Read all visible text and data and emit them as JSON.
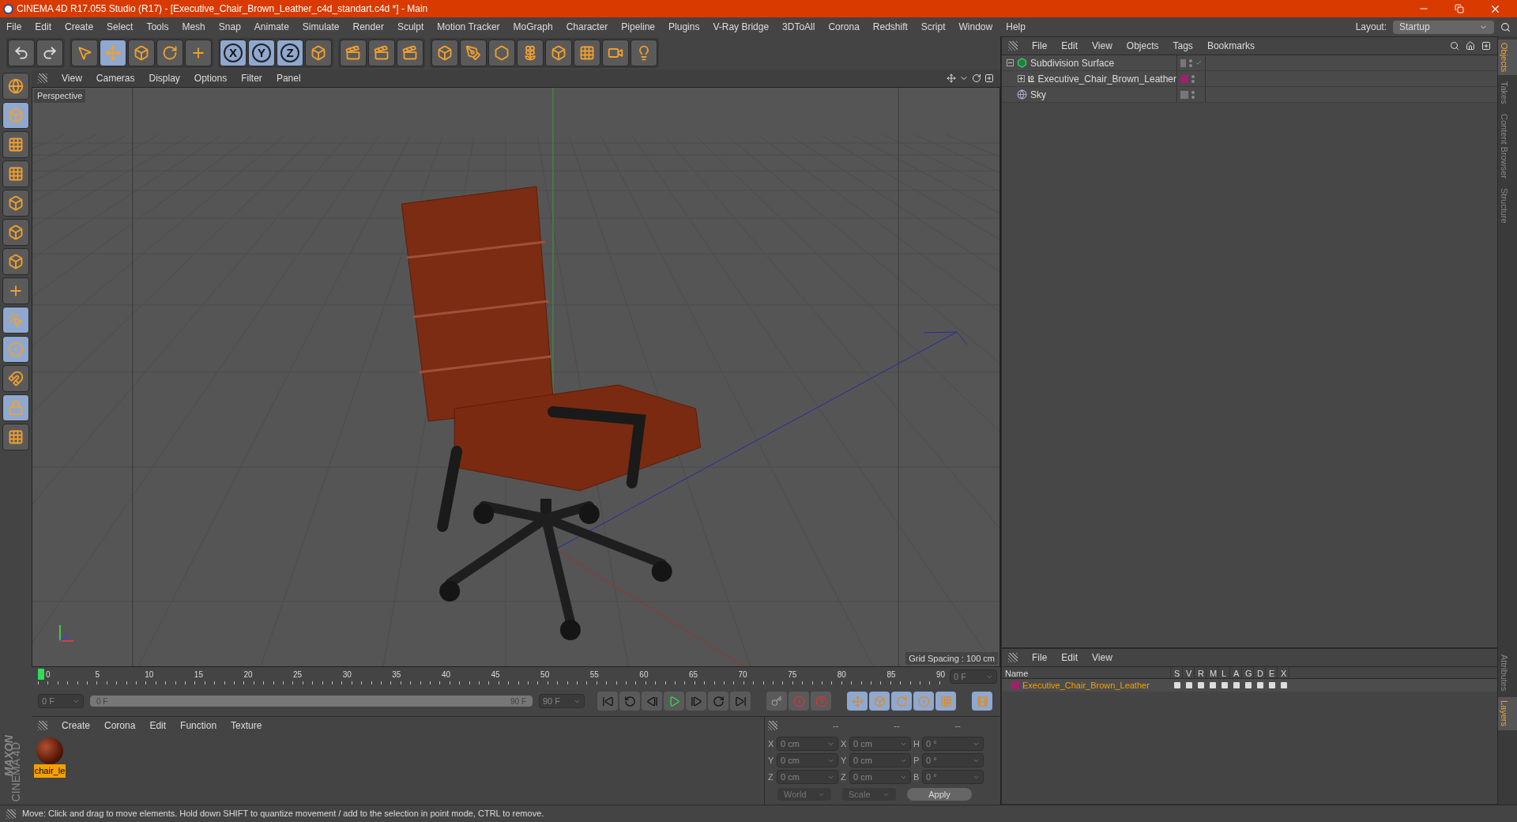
{
  "window": {
    "title": "CINEMA 4D R17.055 Studio (R17) - [Executive_Chair_Brown_Leather_c4d_standart.c4d *] - Main"
  },
  "menu_bar": [
    "File",
    "Edit",
    "Create",
    "Select",
    "Tools",
    "Mesh",
    "Snap",
    "Animate",
    "Simulate",
    "Render",
    "Sculpt",
    "Motion Tracker",
    "MoGraph",
    "Character",
    "Pipeline",
    "Plugins",
    "V-Ray Bridge",
    "3DToAll",
    "Corona",
    "Redshift",
    "Script",
    "Window",
    "Help"
  ],
  "layout": {
    "label": "Layout:",
    "value": "Startup"
  },
  "toolbar": {
    "groups": [
      [
        {
          "kind": "undo",
          "selected": false
        },
        {
          "kind": "redo",
          "selected": false
        }
      ],
      [
        {
          "kind": "cursor",
          "selected": false
        },
        {
          "kind": "move",
          "selected": true
        },
        {
          "kind": "scale",
          "selected": false
        },
        {
          "kind": "rotate",
          "selected": false
        },
        {
          "kind": "cross",
          "selected": false
        }
      ],
      [
        {
          "kind": "axis",
          "label": "X",
          "selected": true
        },
        {
          "kind": "axis",
          "label": "Y",
          "selected": true
        },
        {
          "kind": "axis",
          "label": "Z",
          "selected": true
        },
        {
          "kind": "coords",
          "selected": false
        }
      ],
      [
        {
          "kind": "render",
          "selected": false
        },
        {
          "kind": "render",
          "selected": false
        },
        {
          "kind": "render",
          "selected": false
        }
      ],
      [
        {
          "kind": "cube",
          "selected": false
        },
        {
          "kind": "pen",
          "selected": false
        },
        {
          "kind": "subdiv",
          "selected": false
        },
        {
          "kind": "cloner",
          "selected": false
        },
        {
          "kind": "deformer",
          "selected": false
        },
        {
          "kind": "floor",
          "selected": false
        },
        {
          "kind": "camera",
          "selected": false
        },
        {
          "kind": "light",
          "selected": false
        }
      ]
    ]
  },
  "left_tools": [
    {
      "kind": "model",
      "selected": false
    },
    {
      "kind": "object",
      "selected": true
    },
    {
      "kind": "texture",
      "selected": false
    },
    {
      "kind": "grid",
      "selected": false
    },
    {
      "kind": "points",
      "selected": false
    },
    {
      "kind": "edges",
      "selected": false
    },
    {
      "kind": "polygons",
      "selected": false
    },
    {
      "kind": "axis",
      "selected": false
    },
    {
      "kind": "tweak",
      "selected": true
    },
    {
      "kind": "snap",
      "selected": true
    },
    {
      "kind": "magnet",
      "selected": false
    },
    {
      "kind": "lock",
      "selected": true
    },
    {
      "kind": "workplane",
      "selected": false
    }
  ],
  "viewport": {
    "menu": [
      "View",
      "Cameras",
      "Display",
      "Options",
      "Filter",
      "Panel"
    ],
    "camera": "Perspective",
    "grid_spacing": "Grid Spacing : 100 cm"
  },
  "timeline": {
    "ticks": [
      "0",
      "5",
      "10",
      "15",
      "20",
      "25",
      "30",
      "35",
      "40",
      "45",
      "50",
      "55",
      "60",
      "65",
      "70",
      "75",
      "80",
      "85",
      "90"
    ],
    "current_frame": "0 F",
    "start": "0 F",
    "range": {
      "start": "0 F",
      "end": "90 F",
      "level": 1
    },
    "end": "90 F"
  },
  "materials": {
    "menu": [
      "Create",
      "Corona",
      "Edit",
      "Function",
      "Texture"
    ],
    "items": [
      {
        "name": "chair_le",
        "selected": true
      }
    ]
  },
  "coordinates": {
    "headers": [
      "--",
      "--",
      "--"
    ],
    "rows": [
      {
        "axis": "X",
        "position": "0 cm",
        "size_axis": "X",
        "size": "0 cm",
        "rot_axis": "H",
        "rotation": "0 °"
      },
      {
        "axis": "Y",
        "position": "0 cm",
        "size_axis": "Y",
        "size": "0 cm",
        "rot_axis": "P",
        "rotation": "0 °"
      },
      {
        "axis": "Z",
        "position": "0 cm",
        "size_axis": "Z",
        "size": "0 cm",
        "rot_axis": "B",
        "rotation": "0 °"
      }
    ],
    "mode": "World",
    "size_mode": "Scale",
    "apply": "Apply"
  },
  "brand": {
    "company": "MAXON",
    "product": "CINEMA 4D"
  },
  "status_bar": "Move: Click and drag to move elements. Hold down SHIFT to quantize movement / add to the selection in point mode, CTRL to remove.",
  "objects": {
    "menu": [
      "File",
      "Edit",
      "View",
      "Objects",
      "Tags",
      "Bookmarks"
    ],
    "items": [
      {
        "name": "Subdivision Surface",
        "kind": "subdiv",
        "expanded": true,
        "checked": true,
        "children": [
          {
            "name": "Executive_Chair_Brown_Leather",
            "kind": "null",
            "expanded": false,
            "checked": false,
            "color": "#a0206e"
          }
        ]
      },
      {
        "name": "Sky",
        "kind": "sky",
        "checked": false
      }
    ]
  },
  "right_tabs": [
    {
      "label": "Objects",
      "selected": true
    },
    {
      "label": "Takes",
      "selected": false
    },
    {
      "label": "Content Browser",
      "selected": false
    },
    {
      "label": "Structure",
      "selected": false
    }
  ],
  "layers": {
    "menu": [
      "File",
      "Edit",
      "View"
    ],
    "columns": [
      "Name",
      "S",
      "V",
      "R",
      "M",
      "L",
      "A",
      "G",
      "D",
      "E",
      "X"
    ],
    "rows": [
      {
        "name": "Executive_Chair_Brown_Leather",
        "color": "#a0206e"
      }
    ]
  },
  "bottom_tabs": [
    {
      "label": "Attributes",
      "selected": false
    },
    {
      "label": "Layers",
      "selected": true
    }
  ]
}
